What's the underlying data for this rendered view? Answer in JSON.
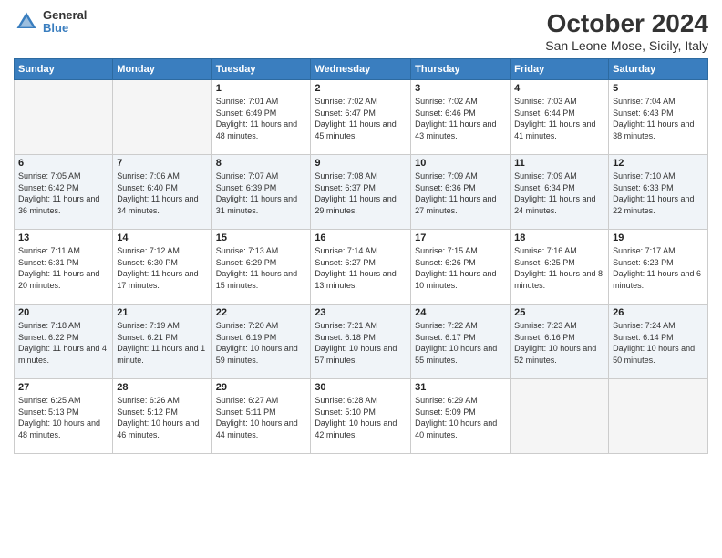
{
  "logo": {
    "line1": "General",
    "line2": "Blue"
  },
  "header": {
    "title": "October 2024",
    "subtitle": "San Leone Mose, Sicily, Italy"
  },
  "weekdays": [
    "Sunday",
    "Monday",
    "Tuesday",
    "Wednesday",
    "Thursday",
    "Friday",
    "Saturday"
  ],
  "weeks": [
    [
      {
        "day": "",
        "info": ""
      },
      {
        "day": "",
        "info": ""
      },
      {
        "day": "1",
        "info": "Sunrise: 7:01 AM\nSunset: 6:49 PM\nDaylight: 11 hours and 48 minutes."
      },
      {
        "day": "2",
        "info": "Sunrise: 7:02 AM\nSunset: 6:47 PM\nDaylight: 11 hours and 45 minutes."
      },
      {
        "day": "3",
        "info": "Sunrise: 7:02 AM\nSunset: 6:46 PM\nDaylight: 11 hours and 43 minutes."
      },
      {
        "day": "4",
        "info": "Sunrise: 7:03 AM\nSunset: 6:44 PM\nDaylight: 11 hours and 41 minutes."
      },
      {
        "day": "5",
        "info": "Sunrise: 7:04 AM\nSunset: 6:43 PM\nDaylight: 11 hours and 38 minutes."
      }
    ],
    [
      {
        "day": "6",
        "info": "Sunrise: 7:05 AM\nSunset: 6:42 PM\nDaylight: 11 hours and 36 minutes."
      },
      {
        "day": "7",
        "info": "Sunrise: 7:06 AM\nSunset: 6:40 PM\nDaylight: 11 hours and 34 minutes."
      },
      {
        "day": "8",
        "info": "Sunrise: 7:07 AM\nSunset: 6:39 PM\nDaylight: 11 hours and 31 minutes."
      },
      {
        "day": "9",
        "info": "Sunrise: 7:08 AM\nSunset: 6:37 PM\nDaylight: 11 hours and 29 minutes."
      },
      {
        "day": "10",
        "info": "Sunrise: 7:09 AM\nSunset: 6:36 PM\nDaylight: 11 hours and 27 minutes."
      },
      {
        "day": "11",
        "info": "Sunrise: 7:09 AM\nSunset: 6:34 PM\nDaylight: 11 hours and 24 minutes."
      },
      {
        "day": "12",
        "info": "Sunrise: 7:10 AM\nSunset: 6:33 PM\nDaylight: 11 hours and 22 minutes."
      }
    ],
    [
      {
        "day": "13",
        "info": "Sunrise: 7:11 AM\nSunset: 6:31 PM\nDaylight: 11 hours and 20 minutes."
      },
      {
        "day": "14",
        "info": "Sunrise: 7:12 AM\nSunset: 6:30 PM\nDaylight: 11 hours and 17 minutes."
      },
      {
        "day": "15",
        "info": "Sunrise: 7:13 AM\nSunset: 6:29 PM\nDaylight: 11 hours and 15 minutes."
      },
      {
        "day": "16",
        "info": "Sunrise: 7:14 AM\nSunset: 6:27 PM\nDaylight: 11 hours and 13 minutes."
      },
      {
        "day": "17",
        "info": "Sunrise: 7:15 AM\nSunset: 6:26 PM\nDaylight: 11 hours and 10 minutes."
      },
      {
        "day": "18",
        "info": "Sunrise: 7:16 AM\nSunset: 6:25 PM\nDaylight: 11 hours and 8 minutes."
      },
      {
        "day": "19",
        "info": "Sunrise: 7:17 AM\nSunset: 6:23 PM\nDaylight: 11 hours and 6 minutes."
      }
    ],
    [
      {
        "day": "20",
        "info": "Sunrise: 7:18 AM\nSunset: 6:22 PM\nDaylight: 11 hours and 4 minutes."
      },
      {
        "day": "21",
        "info": "Sunrise: 7:19 AM\nSunset: 6:21 PM\nDaylight: 11 hours and 1 minute."
      },
      {
        "day": "22",
        "info": "Sunrise: 7:20 AM\nSunset: 6:19 PM\nDaylight: 10 hours and 59 minutes."
      },
      {
        "day": "23",
        "info": "Sunrise: 7:21 AM\nSunset: 6:18 PM\nDaylight: 10 hours and 57 minutes."
      },
      {
        "day": "24",
        "info": "Sunrise: 7:22 AM\nSunset: 6:17 PM\nDaylight: 10 hours and 55 minutes."
      },
      {
        "day": "25",
        "info": "Sunrise: 7:23 AM\nSunset: 6:16 PM\nDaylight: 10 hours and 52 minutes."
      },
      {
        "day": "26",
        "info": "Sunrise: 7:24 AM\nSunset: 6:14 PM\nDaylight: 10 hours and 50 minutes."
      }
    ],
    [
      {
        "day": "27",
        "info": "Sunrise: 6:25 AM\nSunset: 5:13 PM\nDaylight: 10 hours and 48 minutes."
      },
      {
        "day": "28",
        "info": "Sunrise: 6:26 AM\nSunset: 5:12 PM\nDaylight: 10 hours and 46 minutes."
      },
      {
        "day": "29",
        "info": "Sunrise: 6:27 AM\nSunset: 5:11 PM\nDaylight: 10 hours and 44 minutes."
      },
      {
        "day": "30",
        "info": "Sunrise: 6:28 AM\nSunset: 5:10 PM\nDaylight: 10 hours and 42 minutes."
      },
      {
        "day": "31",
        "info": "Sunrise: 6:29 AM\nSunset: 5:09 PM\nDaylight: 10 hours and 40 minutes."
      },
      {
        "day": "",
        "info": ""
      },
      {
        "day": "",
        "info": ""
      }
    ]
  ]
}
